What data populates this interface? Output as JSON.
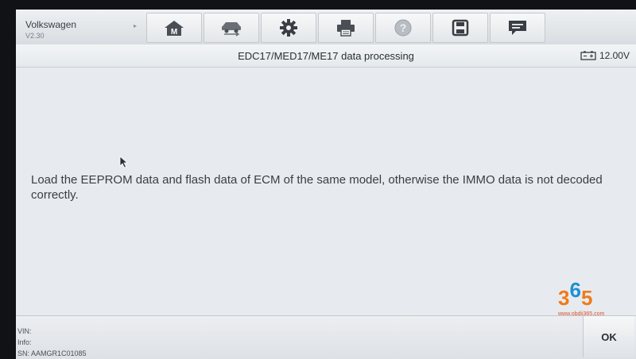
{
  "app": {
    "brand": "Volkswagen",
    "version": "V2.30"
  },
  "toolbar": {
    "items": [
      {
        "label": "M",
        "icon": "home-icon"
      },
      {
        "icon": "vehicle-swap-icon"
      },
      {
        "icon": "gear-icon"
      },
      {
        "icon": "printer-icon"
      },
      {
        "icon": "help-icon"
      },
      {
        "icon": "save-icon"
      },
      {
        "icon": "message-icon"
      }
    ]
  },
  "header": {
    "title": "EDC17/MED17/ME17 data processing",
    "voltage": "12.00V"
  },
  "main": {
    "message": "Load the EEPROM data and flash data of ECM of the same model, otherwise the IMMO data is not decoded correctly."
  },
  "footer": {
    "vin": "VIN:",
    "info": "Info:",
    "sn": "SN: AAMGR1C01085",
    "ok_label": "OK"
  },
  "watermark": {
    "d1": "3",
    "d2": "6",
    "d3": "5",
    "url": "www.obdii365.com"
  },
  "colors": {
    "accent_orange": "#f07a1a",
    "accent_blue": "#1e8fd6",
    "screen_bg": "#e7ebef"
  }
}
